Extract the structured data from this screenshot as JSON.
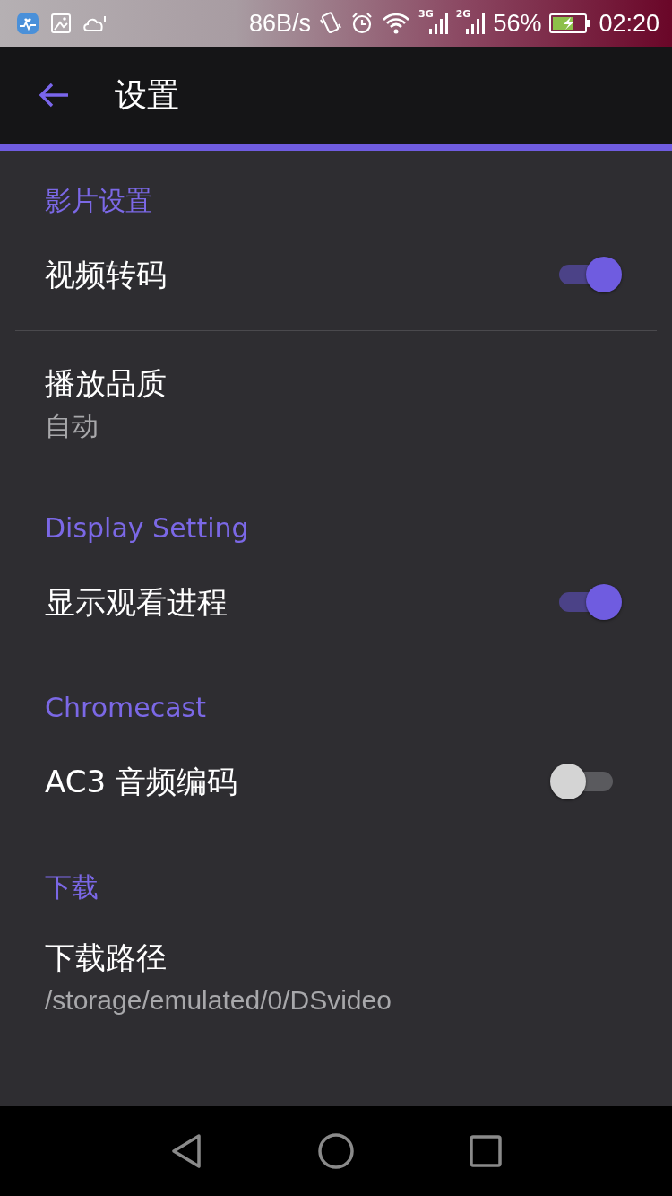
{
  "status_bar": {
    "speed": "86B/s",
    "networks": [
      {
        "label": "3G"
      },
      {
        "label": "2G"
      }
    ],
    "battery": "56%",
    "time": "02:20"
  },
  "app_bar": {
    "title": "设置"
  },
  "sections": [
    {
      "header": "影片设置",
      "items": [
        {
          "kind": "switch",
          "title": "视频转码",
          "on": true
        },
        {
          "kind": "divider"
        },
        {
          "kind": "value",
          "title": "播放品质",
          "value": "自动"
        }
      ]
    },
    {
      "header": "Display Setting",
      "items": [
        {
          "kind": "switch",
          "title": "显示观看进程",
          "on": true
        }
      ]
    },
    {
      "header": "Chromecast",
      "items": [
        {
          "kind": "switch",
          "title": "AC3 音频编码",
          "on": false
        }
      ]
    },
    {
      "header": "下载",
      "items": [
        {
          "kind": "value",
          "title": "下载路径",
          "value": "/storage/emulated/0/DSvideo"
        }
      ]
    }
  ]
}
